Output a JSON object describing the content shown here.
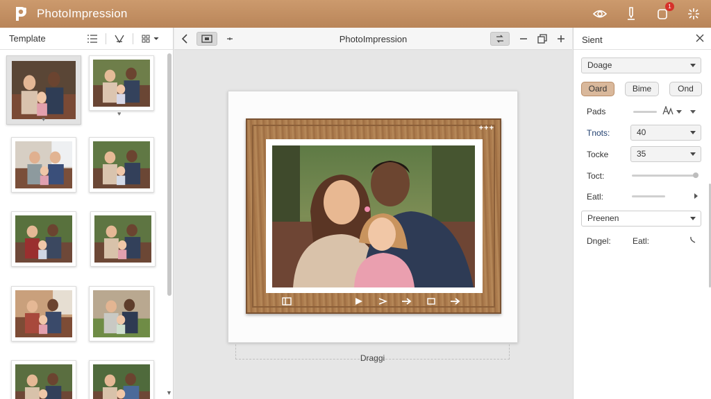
{
  "app": {
    "name": "PhotoImpression",
    "notification_count": "1"
  },
  "left_panel": {
    "title": "Template"
  },
  "center": {
    "doc_title": "PhotoImpression",
    "dropzone_label": "Draggi",
    "frame_plus": "+++"
  },
  "right_panel": {
    "title": "Sient",
    "preset_select": "Doage",
    "pills": [
      "Oard",
      "Bime",
      "Ond"
    ],
    "active_pill": 0,
    "props": {
      "pads_label": "Pads",
      "tints_label": "Tnots:",
      "tints_value": "40",
      "tocke_label": "Tocke",
      "tocke_value": "35",
      "toct_label": "Toct:",
      "eatl_label": "Eatl:",
      "preset2_select": "Preenen",
      "dragel_label": "Dngel:",
      "eatl2_label": "Eatl:"
    }
  },
  "colors": {
    "titlebar": "#c28f63",
    "accent_pill": "#d9b89b",
    "badge": "#d6312a"
  },
  "icons": [
    "app-logo-icon",
    "eye-icon",
    "pen-icon",
    "bell-icon",
    "sparkle-icon",
    "list-icon",
    "filter-icon",
    "grid-icon",
    "chevron-left-icon",
    "image-icon",
    "swap-icon",
    "crop-icon",
    "minus-icon",
    "copy-icon",
    "plus-icon",
    "close-icon"
  ]
}
